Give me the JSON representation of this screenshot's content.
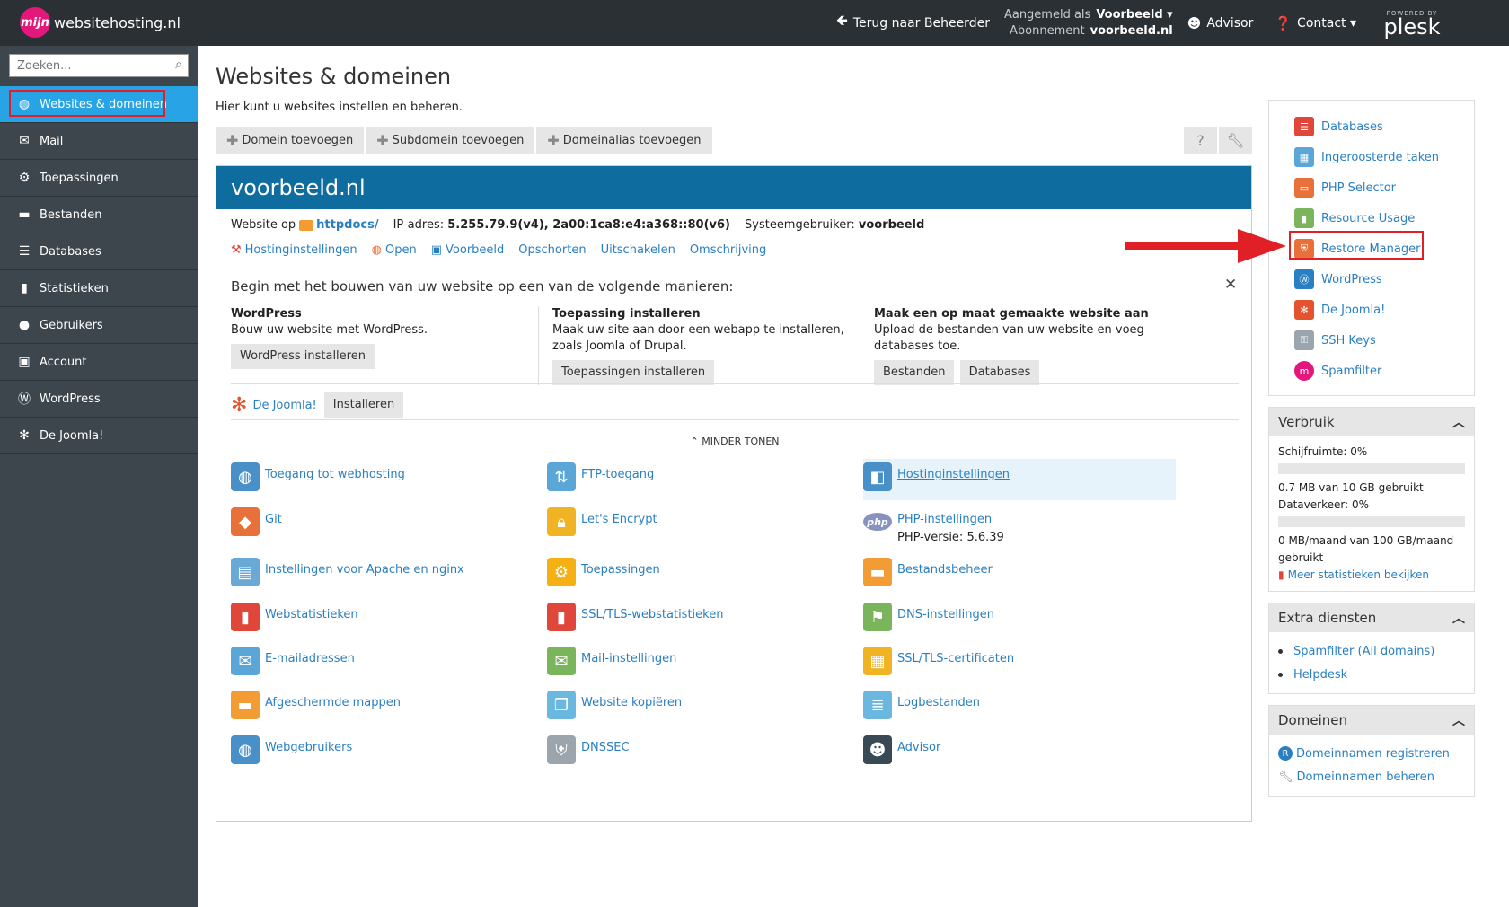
{
  "topbar": {
    "logo_mark": "mijn",
    "logo_text": "websitehosting.nl",
    "back": "Terug naar Beheerder",
    "user_label": "Aangemeld als",
    "user_value": "Voorbeeld ▾",
    "sub_label": "Abonnement",
    "sub_value": "voorbeeld.nl",
    "advisor": "Advisor",
    "contact": "Contact ▾",
    "powered": "POWERED BY",
    "plesk": "plesk"
  },
  "sidebar": {
    "search_placeholder": "Zoeken...",
    "items": [
      {
        "label": "Websites & domeinen",
        "icon": "globe-icon"
      },
      {
        "label": "Mail",
        "icon": "envelope-icon"
      },
      {
        "label": "Toepassingen",
        "icon": "gear-icon"
      },
      {
        "label": "Bestanden",
        "icon": "folder-icon"
      },
      {
        "label": "Databases",
        "icon": "database-icon"
      },
      {
        "label": "Statistieken",
        "icon": "chart-icon"
      },
      {
        "label": "Gebruikers",
        "icon": "user-icon"
      },
      {
        "label": "Account",
        "icon": "account-icon"
      },
      {
        "label": "WordPress",
        "icon": "wordpress-icon"
      },
      {
        "label": "De Joomla!",
        "icon": "joomla-icon"
      }
    ]
  },
  "main": {
    "title": "Websites & domeinen",
    "desc": "Hier kunt u websites instellen en beheren.",
    "toolbar": [
      "Domein toevoegen",
      "Subdomein toevoegen",
      "Domeinalias toevoegen"
    ],
    "domain": "voorbeeld.nl",
    "info": {
      "website_label": "Website op",
      "website_path": "httpdocs/",
      "ip_label": "IP-adres:",
      "ip_value": "5.255.79.9(v4), 2a00:1ca8:e4:a368::80(v6)",
      "sysuser_label": "Systeemgebruiker:",
      "sysuser_value": "voorbeeld"
    },
    "links": [
      "Hostinginstellingen",
      "Open",
      "Voorbeeld",
      "Opschorten",
      "Uitschakelen",
      "Omschrijving"
    ],
    "build_title": "Begin met het bouwen van uw website op een van de volgende manieren:",
    "build": [
      {
        "h": "WordPress",
        "t": "Bouw uw website met WordPress.",
        "buttons": [
          "WordPress installeren"
        ]
      },
      {
        "h": "Toepassing installeren",
        "t": "Maak uw site aan door een webapp te installeren, zoals Joomla of Drupal.",
        "buttons": [
          "Toepassingen installeren"
        ]
      },
      {
        "h": "Maak een op maat gemaakte website aan",
        "t": "Upload de bestanden van uw website en voeg databases toe.",
        "buttons": [
          "Bestanden",
          "Databases"
        ]
      }
    ],
    "joomla_link": "De Joomla!",
    "joomla_btn": "Installeren",
    "less": "MINDER TONEN",
    "tools": [
      {
        "label": "Toegang tot webhosting",
        "icon": "globe-flag-icon",
        "color": "#4a90c8"
      },
      {
        "label": "FTP-toegang",
        "icon": "ftp-icon",
        "color": "#5aa6d6"
      },
      {
        "label": "Hostinginstellingen",
        "icon": "hosting-settings-icon",
        "color": "#4a90c8"
      },
      {
        "label": "Git",
        "icon": "git-icon",
        "color": "#e8703a"
      },
      {
        "label": "Let's Encrypt",
        "icon": "lock-icon",
        "color": "#f0b323"
      },
      {
        "label": "PHP-instellingen",
        "icon": "php-icon",
        "color": "#8892bf",
        "sub": "PHP-versie: 5.6.39"
      },
      {
        "label": "Instellingen voor Apache en nginx",
        "icon": "server-icon",
        "color": "#6aa8d6"
      },
      {
        "label": "Toepassingen",
        "icon": "gear-icon",
        "color": "#f5b014"
      },
      {
        "label": "Bestandsbeheer",
        "icon": "folder-icon",
        "color": "#f39c33"
      },
      {
        "label": "Webstatistieken",
        "icon": "bars-icon",
        "color": "#e0473a"
      },
      {
        "label": "SSL/TLS-webstatistieken",
        "icon": "secure-stats-icon",
        "color": "#e0473a"
      },
      {
        "label": "DNS-instellingen",
        "icon": "dns-icon",
        "color": "#7ab55c"
      },
      {
        "label": "E-mailadressen",
        "icon": "envelope-icon",
        "color": "#5aa6d6"
      },
      {
        "label": "Mail-instellingen",
        "icon": "mail-settings-icon",
        "color": "#7ab55c"
      },
      {
        "label": "SSL/TLS-certificaten",
        "icon": "certificate-icon",
        "color": "#f0b323"
      },
      {
        "label": "Afgeschermde mappen",
        "icon": "locked-folder-icon",
        "color": "#f39c33"
      },
      {
        "label": "Website kopiëren",
        "icon": "copy-icon",
        "color": "#6ab8e0"
      },
      {
        "label": "Logbestanden",
        "icon": "log-icon",
        "color": "#6ab8e0"
      },
      {
        "label": "Webgebruikers",
        "icon": "web-users-icon",
        "color": "#4a90c8"
      },
      {
        "label": "DNSSEC",
        "icon": "shield-icon",
        "color": "#9aa5ad"
      },
      {
        "label": "Advisor",
        "icon": "owl-icon",
        "color": "#3a4a55"
      }
    ]
  },
  "right": {
    "links": [
      {
        "label": "Databases",
        "icon": "database-icon",
        "color": "#e0473a"
      },
      {
        "label": "Ingeroosterde taken",
        "icon": "calendar-icon",
        "color": "#5aa6d6"
      },
      {
        "label": "PHP Selector",
        "icon": "php-selector-icon",
        "color": "#e8703a"
      },
      {
        "label": "Resource Usage",
        "icon": "usage-icon",
        "color": "#7ab55c"
      },
      {
        "label": "Restore Manager",
        "icon": "restore-shield-icon",
        "color": "#e8703a"
      },
      {
        "label": "WordPress",
        "icon": "wordpress-icon",
        "color": "#2a7fc1"
      },
      {
        "label": "De Joomla!",
        "icon": "joomla-icon",
        "color": "#e4532e"
      },
      {
        "label": "SSH Keys",
        "icon": "key-icon",
        "color": "#9aa5ad"
      },
      {
        "label": "Spamfilter",
        "icon": "spamfilter-icon",
        "color": "#e4187c"
      }
    ],
    "usage": {
      "title": "Verbruik",
      "disk_label": "Schijfruimte: 0%",
      "disk_pct": 0,
      "disk_text": "0.7 MB van 10 GB gebruikt",
      "traffic_label": "Dataverkeer: 0%",
      "traffic_pct": 0,
      "traffic_text": "0 MB/maand van 100 GB/maand gebruikt",
      "more": "Meer statistieken bekijken"
    },
    "extra": {
      "title": "Extra diensten",
      "items": [
        "Spamfilter (All domains)",
        "Helpdesk"
      ]
    },
    "domains": {
      "title": "Domeinen",
      "items": [
        "Domeinnamen registreren",
        "Domeinnamen beheren"
      ]
    }
  }
}
